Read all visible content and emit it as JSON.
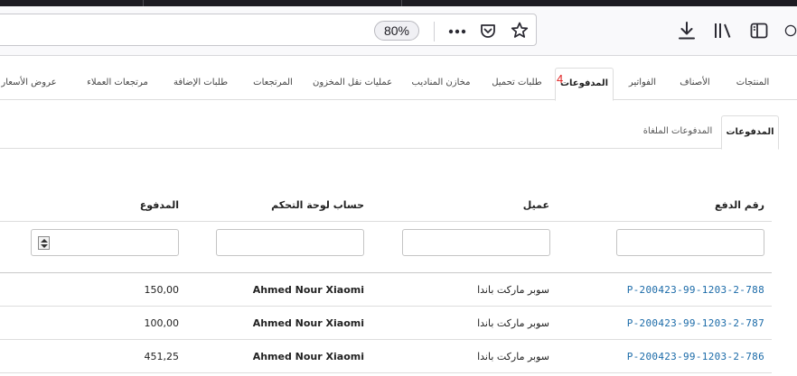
{
  "browser": {
    "zoom_label": "80%",
    "toolbar_icons": [
      "more-actions-icon",
      "pocket-icon",
      "bookmark-star-icon",
      "downloads-icon",
      "library-icon",
      "sidebar-icon"
    ]
  },
  "main_tabs": [
    {
      "label": "المنتجات",
      "active": false
    },
    {
      "label": "الأصناف",
      "active": false
    },
    {
      "label": "الفواتير",
      "active": false
    },
    {
      "label": "المدفوعات",
      "active": true,
      "badge": "4"
    },
    {
      "label": "طلبات تحميل",
      "active": false
    },
    {
      "label": "مخازن المناديب",
      "active": false
    },
    {
      "label": "عمليات نقل المخزون",
      "active": false
    },
    {
      "label": "المرتجعات",
      "active": false
    },
    {
      "label": "طلبات الإضافة",
      "active": false
    },
    {
      "label": "مرتجعات العملاء",
      "active": false
    },
    {
      "label": "عروض الأسعار",
      "active": false
    }
  ],
  "sub_tabs": [
    {
      "label": "المدفوعات",
      "active": true
    },
    {
      "label": "المدفوعات الملغاة",
      "active": false
    }
  ],
  "table": {
    "columns": [
      "رقم الدفع",
      "عميل",
      "حساب لوحة التحكم",
      "المدفوع"
    ],
    "rows": [
      {
        "number": "P-200423-99-1203-2-788",
        "customer": "سوبر ماركت باندا",
        "account": "Ahmed Nour Xiaomi",
        "paid": "150,00"
      },
      {
        "number": "P-200423-99-1203-2-787",
        "customer": "سوبر ماركت باندا",
        "account": "Ahmed Nour Xiaomi",
        "paid": "100,00"
      },
      {
        "number": "P-200423-99-1203-2-786",
        "customer": "سوبر ماركت باندا",
        "account": "Ahmed Nour Xiaomi",
        "paid": "451,25"
      }
    ]
  },
  "colors": {
    "link": "#1a6aa8",
    "badge": "#e02020",
    "topbar": "#1c1b22"
  }
}
